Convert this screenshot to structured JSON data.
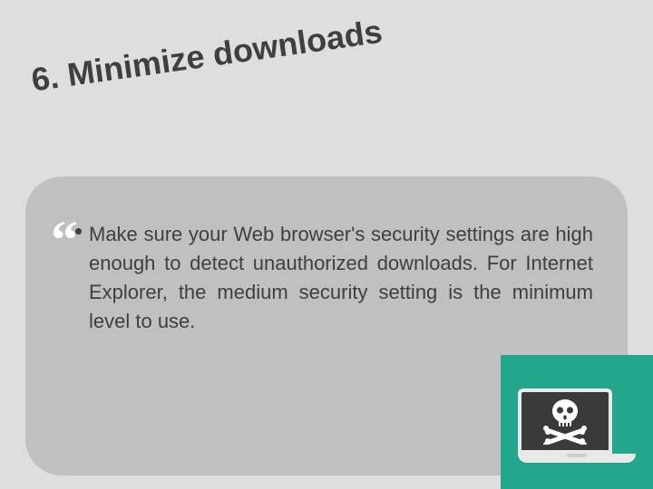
{
  "slide": {
    "title": "6. Minimize downloads",
    "body": "Make sure your Web browser's security settings are high enough to detect unauthorized downloads. For Internet Explorer, the medium security setting is the minimum level to use.",
    "quote_glyph": "“"
  },
  "illustration": {
    "name": "laptop-skull",
    "bg_color": "#23a78c",
    "skull_color": "#ffffff"
  }
}
